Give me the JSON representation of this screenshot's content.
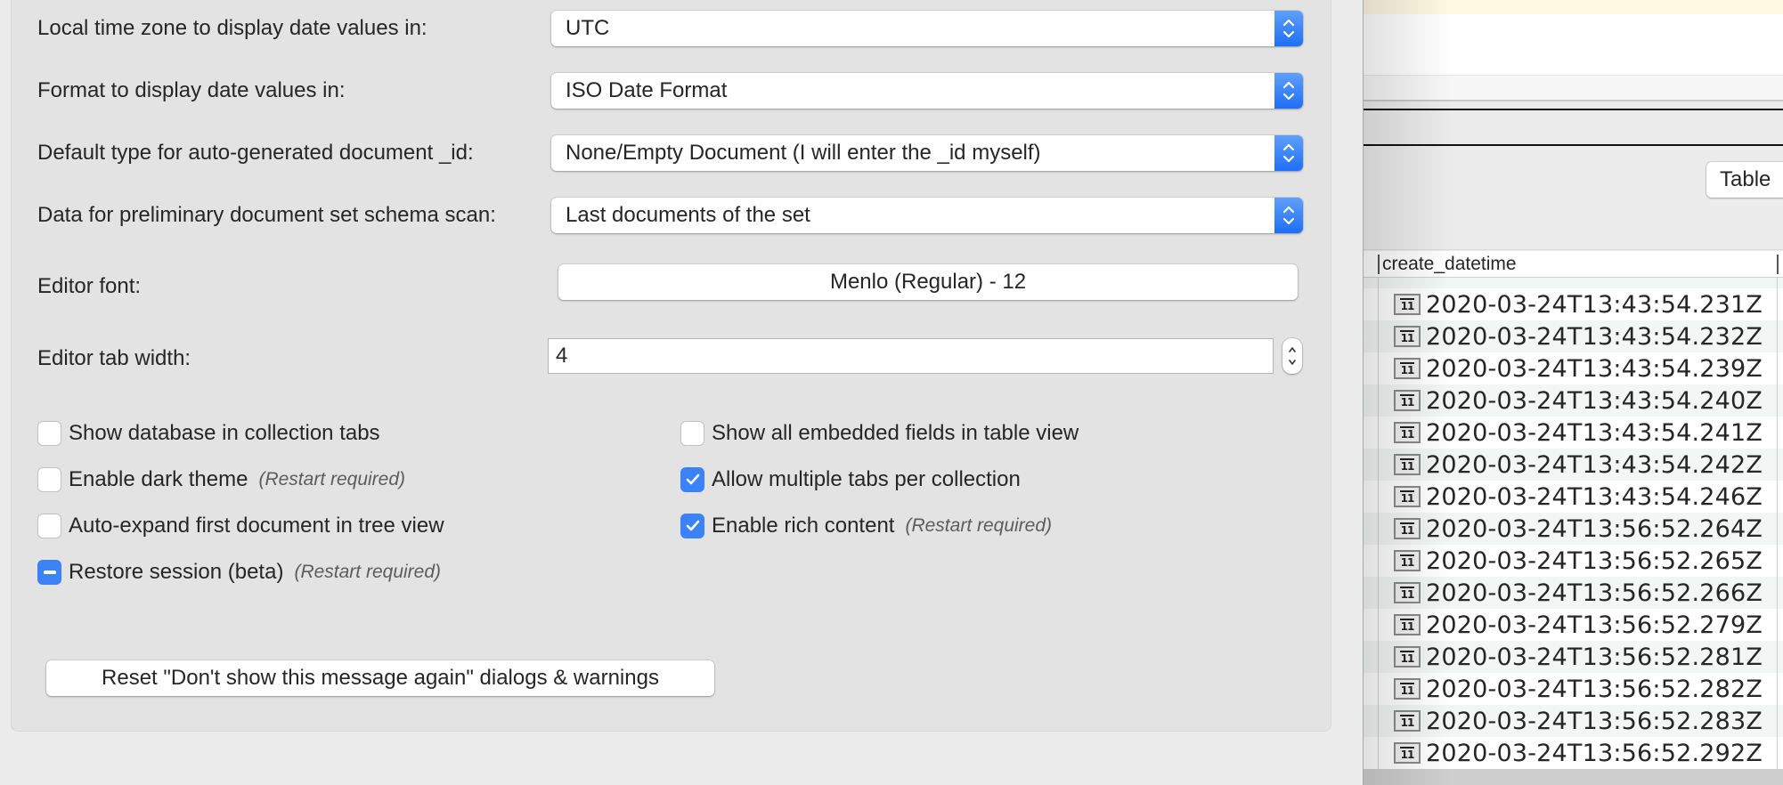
{
  "preferences": {
    "rows": [
      {
        "label": "Local time zone to display date values in:",
        "value": "UTC"
      },
      {
        "label": "Format to display date values in:",
        "value": "ISO Date Format"
      },
      {
        "label": "Default type for auto-generated document _id:",
        "value": "None/Empty Document (I will enter the _id myself)"
      },
      {
        "label": "Data for preliminary document set schema scan:",
        "value": "Last documents of the set"
      }
    ],
    "editor_font": {
      "label": "Editor font:",
      "value": "Menlo (Regular) - 12"
    },
    "editor_tab_width": {
      "label": "Editor tab width:",
      "value": "4"
    },
    "checkboxes_left": [
      {
        "label": "Show database in collection tabs",
        "state": "unchecked",
        "note": ""
      },
      {
        "label": "Enable dark theme",
        "state": "unchecked",
        "note": "(Restart required)"
      },
      {
        "label": "Auto-expand first document in tree view",
        "state": "unchecked",
        "note": ""
      },
      {
        "label": "Restore session (beta)",
        "state": "mixed",
        "note": "(Restart required)"
      }
    ],
    "checkboxes_right": [
      {
        "label": "Show all embedded fields in table view",
        "state": "unchecked",
        "note": ""
      },
      {
        "label": "Allow multiple tabs per collection",
        "state": "checked",
        "note": ""
      },
      {
        "label": "Enable rich content",
        "state": "checked",
        "note": "(Restart required)"
      }
    ],
    "reset_button": "Reset \"Don't show this message again\" dialogs & warnings",
    "accent_color": "#3b82f6"
  },
  "background_window": {
    "view_button": "Table",
    "column_header": "create_datetime",
    "date_icon_text": "11",
    "rows": [
      "2020-03-24T13:43:54.231Z",
      "2020-03-24T13:43:54.232Z",
      "2020-03-24T13:43:54.239Z",
      "2020-03-24T13:43:54.240Z",
      "2020-03-24T13:43:54.241Z",
      "2020-03-24T13:43:54.242Z",
      "2020-03-24T13:43:54.246Z",
      "2020-03-24T13:56:52.264Z",
      "2020-03-24T13:56:52.265Z",
      "2020-03-24T13:56:52.266Z",
      "2020-03-24T13:56:52.279Z",
      "2020-03-24T13:56:52.281Z",
      "2020-03-24T13:56:52.282Z",
      "2020-03-24T13:56:52.283Z",
      "2020-03-24T13:56:52.292Z"
    ]
  }
}
